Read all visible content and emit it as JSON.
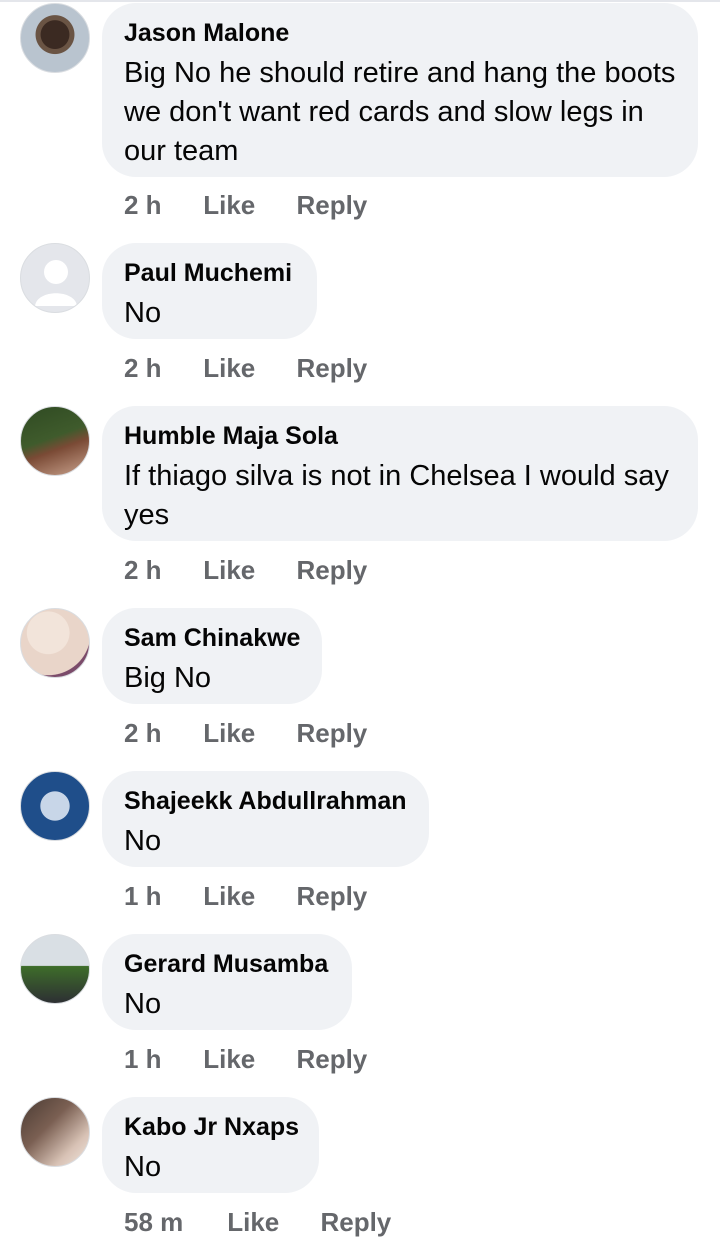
{
  "comments": [
    {
      "author": "Jason Malone",
      "text": "Big No he should retire and hang the boots we don't want red cards and slow legs in our team",
      "time": "2 h",
      "like": "Like",
      "reply": "Reply",
      "avatar_colors": [
        "#b9c4cf",
        "#3b2a22"
      ]
    },
    {
      "author": "Paul Muchemi",
      "text": "No",
      "time": "2 h",
      "like": "Like",
      "reply": "Reply",
      "avatar_colors": [
        "#e4e6eb",
        "#ffffff"
      ]
    },
    {
      "author": "Humble Maja Sola",
      "text": "If thiago silva is not in Chelsea I would say yes",
      "time": "2 h",
      "like": "Like",
      "reply": "Reply",
      "avatar_colors": [
        "#3f5b2c",
        "#7a4a35"
      ]
    },
    {
      "author": "Sam Chinakwe",
      "text": "Big No",
      "time": "2 h",
      "like": "Like",
      "reply": "Reply",
      "avatar_colors": [
        "#e9d5c9",
        "#7b4b6a"
      ]
    },
    {
      "author": "Shajeekk Abdullrahman",
      "text": "No",
      "time": "1 h",
      "like": "Like",
      "reply": "Reply",
      "avatar_colors": [
        "#1f4e8a",
        "#c8d6e8"
      ]
    },
    {
      "author": "Gerard Musamba",
      "text": "No",
      "time": "1 h",
      "like": "Like",
      "reply": "Reply",
      "avatar_colors": [
        "#d9dfe4",
        "#3e6d2a"
      ]
    },
    {
      "author": "Kabo Jr Nxaps",
      "text": "No",
      "time": "58 m",
      "like": "Like",
      "reply": "Reply",
      "avatar_colors": [
        "#4a3b33",
        "#d8c2b5"
      ]
    }
  ]
}
